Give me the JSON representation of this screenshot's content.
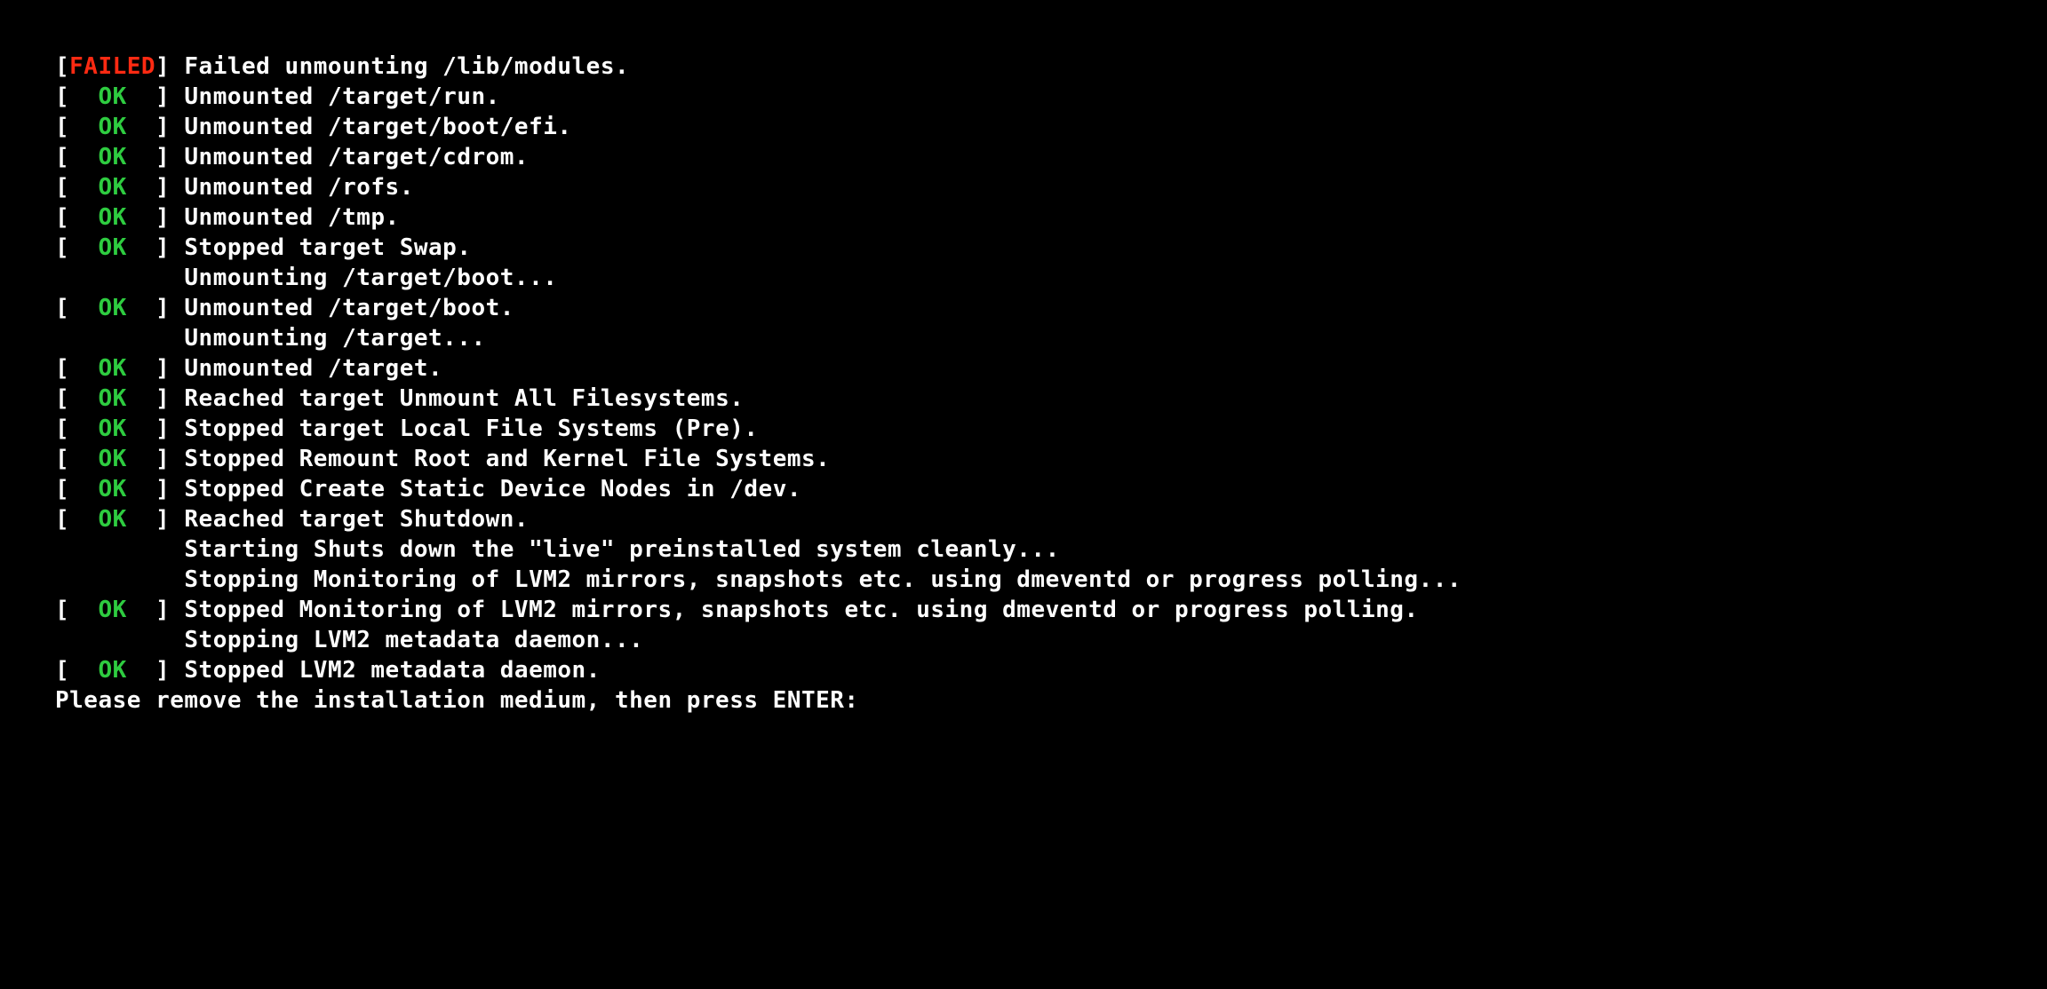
{
  "colors": {
    "background": "#000000",
    "text": "#fefefe",
    "ok": "#2ecc40",
    "failed": "#ff2a12"
  },
  "status_labels": {
    "ok": "OK",
    "failed": "FAILED"
  },
  "indent": "         ",
  "lines": [
    {
      "status": "failed",
      "message": "Failed unmounting /lib/modules."
    },
    {
      "status": "ok",
      "message": "Unmounted /target/run."
    },
    {
      "status": "ok",
      "message": "Unmounted /target/boot/efi."
    },
    {
      "status": "ok",
      "message": "Unmounted /target/cdrom."
    },
    {
      "status": "ok",
      "message": "Unmounted /rofs."
    },
    {
      "status": "ok",
      "message": "Unmounted /tmp."
    },
    {
      "status": "ok",
      "message": "Stopped target Swap."
    },
    {
      "status": "none",
      "message": "Unmounting /target/boot..."
    },
    {
      "status": "ok",
      "message": "Unmounted /target/boot."
    },
    {
      "status": "none",
      "message": "Unmounting /target..."
    },
    {
      "status": "ok",
      "message": "Unmounted /target."
    },
    {
      "status": "ok",
      "message": "Reached target Unmount All Filesystems."
    },
    {
      "status": "ok",
      "message": "Stopped target Local File Systems (Pre)."
    },
    {
      "status": "ok",
      "message": "Stopped Remount Root and Kernel File Systems."
    },
    {
      "status": "ok",
      "message": "Stopped Create Static Device Nodes in /dev."
    },
    {
      "status": "ok",
      "message": "Reached target Shutdown."
    },
    {
      "status": "none",
      "message": "Starting Shuts down the \"live\" preinstalled system cleanly..."
    },
    {
      "status": "none",
      "message": "Stopping Monitoring of LVM2 mirrors, snapshots etc. using dmeventd or progress polling..."
    },
    {
      "status": "ok",
      "message": "Stopped Monitoring of LVM2 mirrors, snapshots etc. using dmeventd or progress polling."
    },
    {
      "status": "none",
      "message": "Stopping LVM2 metadata daemon..."
    },
    {
      "status": "ok",
      "message": "Stopped LVM2 metadata daemon."
    }
  ],
  "prompt": "Please remove the installation medium, then press ENTER:"
}
